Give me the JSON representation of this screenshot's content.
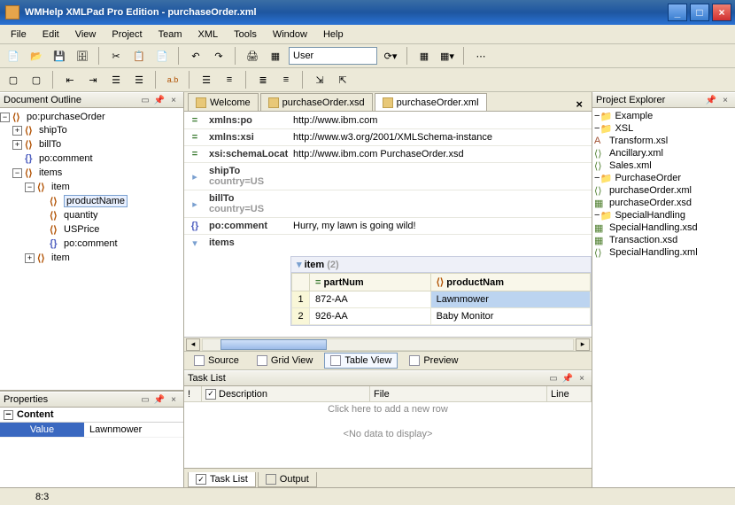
{
  "window": {
    "title": "WMHelp XMLPad Pro Edition - purchaseOrder.xml"
  },
  "menu": {
    "file": "File",
    "edit": "Edit",
    "view": "View",
    "project": "Project",
    "team": "Team",
    "xml": "XML",
    "tools": "Tools",
    "window": "Window",
    "help": "Help"
  },
  "toolbar": {
    "user_label": "User"
  },
  "outline": {
    "title": "Document Outline",
    "root": "po:purchaseOrder",
    "ship": "shipTo",
    "bill": "billTo",
    "comment": "po:comment",
    "items": "items",
    "item": "item",
    "productName": "productName",
    "quantity": "quantity",
    "usprice": "USPrice",
    "pocomment": "po:comment"
  },
  "properties": {
    "title": "Properties",
    "content_hdr": "Content",
    "key": "Value",
    "val": "Lawnmower"
  },
  "tabs": {
    "welcome": "Welcome",
    "xsd": "purchaseOrder.xsd",
    "xml": "purchaseOrder.xml"
  },
  "tableview": {
    "rows": [
      {
        "ic": "=",
        "name": "xmlns:po",
        "val": "http://www.ibm.com"
      },
      {
        "ic": "=",
        "name": "xmlns:xsi",
        "val": "http://www.w3.org/2001/XMLSchema-instance"
      },
      {
        "ic": "=",
        "name": "xsi:schemaLocat",
        "val": "http://www.ibm.com PurchaseOrder.xsd"
      }
    ],
    "shipTo": "shipTo",
    "billTo": "billTo",
    "country": "country=US",
    "pocomment": "po:comment",
    "pocomment_val": "Hurry, my lawn is going wild!",
    "items": "items",
    "sub": {
      "hdr": "item",
      "count": "(2)",
      "cols": {
        "partnum": "partNum",
        "product": "productNam"
      },
      "r1": {
        "n": "1",
        "partnum": "872-AA",
        "product": "Lawnmower"
      },
      "r2": {
        "n": "2",
        "partnum": "926-AA",
        "product": "Baby Monitor"
      }
    }
  },
  "viewbtns": {
    "source": "Source",
    "grid": "Grid View",
    "table": "Table View",
    "preview": "Preview"
  },
  "tasklist": {
    "title": "Task List",
    "desc": "Description",
    "file": "File",
    "line": "Line",
    "addrow": "Click here to add a new row",
    "empty": "<No data to display>"
  },
  "bottomtabs": {
    "task": "Task List",
    "output": "Output"
  },
  "explorer": {
    "title": "Project Explorer",
    "root": "Example",
    "xsl": "XSL",
    "transform": "Transform.xsl",
    "ancillary": "Ancillary.xml",
    "sales": "Sales.xml",
    "po": "PurchaseOrder",
    "poxml": "purchaseOrder.xml",
    "poxsd": "purchaseOrder.xsd",
    "sh": "SpecialHandling",
    "shxsd": "SpecialHandling.xsd",
    "trxsd": "Transaction.xsd",
    "shxml": "SpecialHandling.xml"
  },
  "status": {
    "pos": "8:3"
  }
}
